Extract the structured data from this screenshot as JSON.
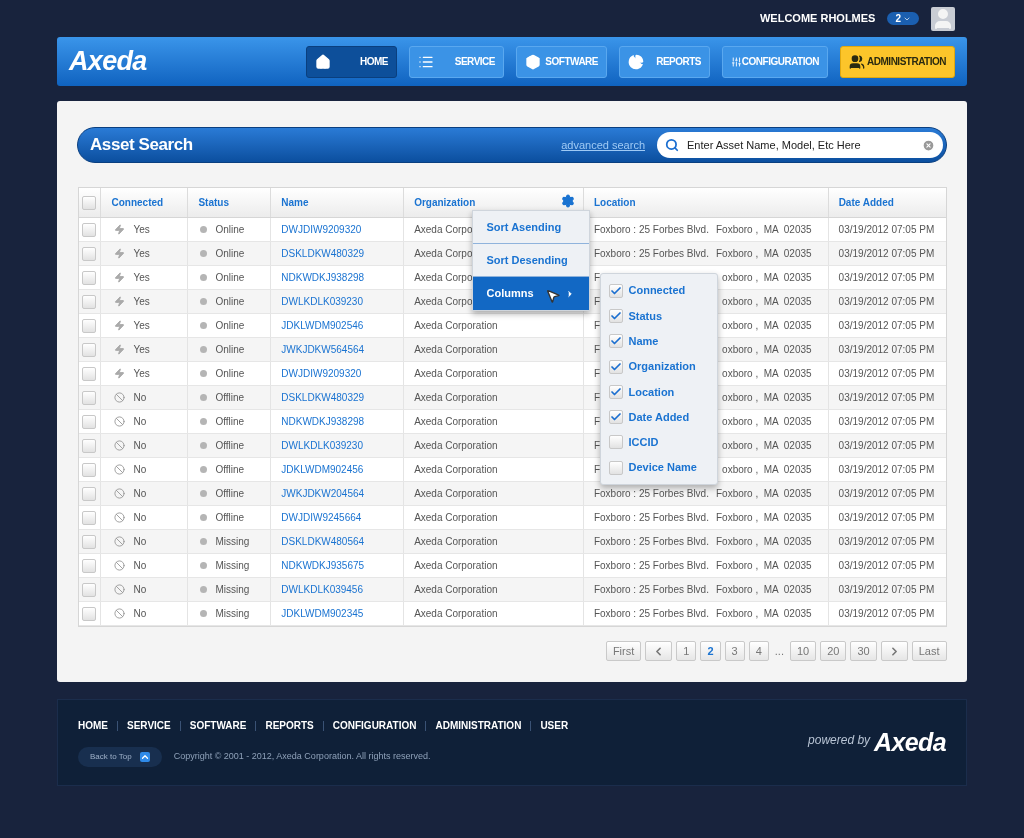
{
  "header": {
    "welcome": "WELCOME RHOLMES",
    "notifications": "2"
  },
  "logo": "Axeda",
  "nav": [
    {
      "label": "HOME",
      "selected": true,
      "kind": "normal"
    },
    {
      "label": "SERVICE",
      "selected": false,
      "kind": "normal"
    },
    {
      "label": "SOFTWARE",
      "selected": false,
      "kind": "normal"
    },
    {
      "label": "REPORTS",
      "selected": false,
      "kind": "normal"
    },
    {
      "label": "CONFIGURATION",
      "selected": false,
      "kind": "normal"
    },
    {
      "label": "ADMINISTRATION",
      "selected": false,
      "kind": "accent"
    }
  ],
  "search": {
    "title": "Asset Search",
    "advanced_link": "advanced search",
    "placeholder": "Enter Asset Name, Model, Etc Here"
  },
  "table": {
    "select_all": false,
    "columns": [
      "Connected",
      "Status",
      "Name",
      "Organization",
      "Location",
      "Date Added"
    ],
    "rows": [
      {
        "checked": false,
        "connected": true,
        "connected_label": "Yes",
        "status": "Online",
        "name": "DWJDIW9209320",
        "organization": "Axeda Corpo",
        "address": "Foxboro : 25 Forbes Blvd.",
        "city": "Foxboro ,  MA  02035",
        "date": "03/19/2012 07:05 PM"
      },
      {
        "checked": false,
        "connected": true,
        "connected_label": "Yes",
        "status": "Online",
        "name": "DSKLDKW480329",
        "organization": "Axeda Corpo",
        "address": "Foxboro : 25 Forbes Blvd.",
        "city": "Foxboro ,  MA  02035",
        "date": "03/19/2012 07:05 PM"
      },
      {
        "checked": false,
        "connected": true,
        "connected_label": "Yes",
        "status": "Online",
        "name": "NDKWDKJ938298",
        "organization": "Axeda Corpo",
        "address": "F",
        "city": "oxboro ,  MA  02035",
        "date": "03/19/2012 07:05 PM"
      },
      {
        "checked": false,
        "connected": true,
        "connected_label": "Yes",
        "status": "Online",
        "name": "DWLKDLK039230",
        "organization": "Axeda Corpo",
        "address": "F",
        "city": "oxboro ,  MA  02035",
        "date": "03/19/2012 07:05 PM"
      },
      {
        "checked": false,
        "connected": true,
        "connected_label": "Yes",
        "status": "Online",
        "name": "JDKLWDM902546",
        "organization": "Axeda Corporation",
        "address": "F",
        "city": "oxboro ,  MA  02035",
        "date": "03/19/2012 07:05 PM"
      },
      {
        "checked": false,
        "connected": true,
        "connected_label": "Yes",
        "status": "Online",
        "name": "JWKJDKW564564",
        "organization": "Axeda Corporation",
        "address": "F",
        "city": "oxboro ,  MA  02035",
        "date": "03/19/2012 07:05 PM"
      },
      {
        "checked": false,
        "connected": true,
        "connected_label": "Yes",
        "status": "Online",
        "name": "DWJDIW9209320",
        "organization": "Axeda Corporation",
        "address": "F",
        "city": "oxboro ,  MA  02035",
        "date": "03/19/2012 07:05 PM"
      },
      {
        "checked": false,
        "connected": false,
        "connected_label": "No",
        "status": "Offline",
        "name": "DSKLDKW480329",
        "organization": "Axeda Corporation",
        "address": "F",
        "city": "oxboro ,  MA  02035",
        "date": "03/19/2012 07:05 PM"
      },
      {
        "checked": false,
        "connected": false,
        "connected_label": "No",
        "status": "Offline",
        "name": "NDKWDKJ938298",
        "organization": "Axeda Corporation",
        "address": "F",
        "city": "oxboro ,  MA  02035",
        "date": "03/19/2012 07:05 PM"
      },
      {
        "checked": false,
        "connected": false,
        "connected_label": "No",
        "status": "Offline",
        "name": "DWLKDLK039230",
        "organization": "Axeda Corporation",
        "address": "F",
        "city": "oxboro ,  MA  02035",
        "date": "03/19/2012 07:05 PM"
      },
      {
        "checked": false,
        "connected": false,
        "connected_label": "No",
        "status": "Offline",
        "name": "JDKLWDM902456",
        "organization": "Axeda Corporation",
        "address": "F",
        "city": "oxboro ,  MA  02035",
        "date": "03/19/2012 07:05 PM"
      },
      {
        "checked": false,
        "connected": false,
        "connected_label": "No",
        "status": "Offline",
        "name": "JWKJDKW204564",
        "organization": "Axeda Corporation",
        "address": "Foxboro : 25 Forbes Blvd.",
        "city": "Foxboro ,  MA  02035",
        "date": "03/19/2012 07:05 PM"
      },
      {
        "checked": false,
        "connected": false,
        "connected_label": "No",
        "status": "Offline",
        "name": "DWJDIW9245664",
        "organization": "Axeda Corporation",
        "address": "Foxboro : 25 Forbes Blvd.",
        "city": "Foxboro ,  MA  02035",
        "date": "03/19/2012 07:05 PM"
      },
      {
        "checked": false,
        "connected": false,
        "connected_label": "No",
        "status": "Missing",
        "name": "DSKLDKW480564",
        "organization": "Axeda Corporation",
        "address": "Foxboro : 25 Forbes Blvd.",
        "city": "Foxboro ,  MA  02035",
        "date": "03/19/2012 07:05 PM"
      },
      {
        "checked": false,
        "connected": false,
        "connected_label": "No",
        "status": "Missing",
        "name": "NDKWDKJ935675",
        "organization": "Axeda Corporation",
        "address": "Foxboro : 25 Forbes Blvd.",
        "city": "Foxboro ,  MA  02035",
        "date": "03/19/2012 07:05 PM"
      },
      {
        "checked": false,
        "connected": false,
        "connected_label": "No",
        "status": "Missing",
        "name": "DWLKDLK039456",
        "organization": "Axeda Corporation",
        "address": "Foxboro : 25 Forbes Blvd.",
        "city": "Foxboro ,  MA  02035",
        "date": "03/19/2012 07:05 PM"
      },
      {
        "checked": false,
        "connected": false,
        "connected_label": "No",
        "status": "Missing",
        "name": "JDKLWDM902345",
        "organization": "Axeda Corporation",
        "address": "Foxboro : 25 Forbes Blvd.",
        "city": "Foxboro ,  MA  02035",
        "date": "03/19/2012 07:05 PM"
      }
    ]
  },
  "column_menu": {
    "items": [
      {
        "label": "Sort Asending",
        "selected": false
      },
      {
        "label": "Sort Desending",
        "selected": false
      },
      {
        "label": "Columns",
        "selected": true
      }
    ],
    "column_options": [
      {
        "label": "Connected",
        "checked": true
      },
      {
        "label": "Status",
        "checked": true
      },
      {
        "label": "Name",
        "checked": true
      },
      {
        "label": "Organization",
        "checked": true
      },
      {
        "label": "Location",
        "checked": true
      },
      {
        "label": "Date Added",
        "checked": true
      },
      {
        "label": "ICCID",
        "checked": false
      },
      {
        "label": "Device Name",
        "checked": false
      }
    ]
  },
  "pagination": [
    {
      "kind": "text",
      "label": "First",
      "selected": false
    },
    {
      "kind": "prev",
      "selected": false
    },
    {
      "kind": "text",
      "label": "1",
      "selected": false
    },
    {
      "kind": "text",
      "label": "2",
      "selected": true
    },
    {
      "kind": "text",
      "label": "3",
      "selected": false
    },
    {
      "kind": "text",
      "label": "4",
      "selected": false
    },
    {
      "kind": "ellipsis",
      "label": "...",
      "selected": false
    },
    {
      "kind": "text",
      "label": "10",
      "selected": false
    },
    {
      "kind": "text",
      "label": "20",
      "selected": false
    },
    {
      "kind": "text",
      "label": "30",
      "selected": false
    },
    {
      "kind": "next",
      "selected": false
    },
    {
      "kind": "text",
      "label": "Last",
      "selected": false
    }
  ],
  "footer": {
    "links": [
      "HOME",
      "SERVICE",
      "SOFTWARE",
      "REPORTS",
      "CONFIGURATION",
      "ADMINISTRATION",
      "USER"
    ],
    "back_to_top": "Back to Top",
    "copyright": "Copyright © 2001 - 2012, Axeda Corporation. All rights reserved.",
    "powered_by": "powered by",
    "logo": "Axeda"
  }
}
